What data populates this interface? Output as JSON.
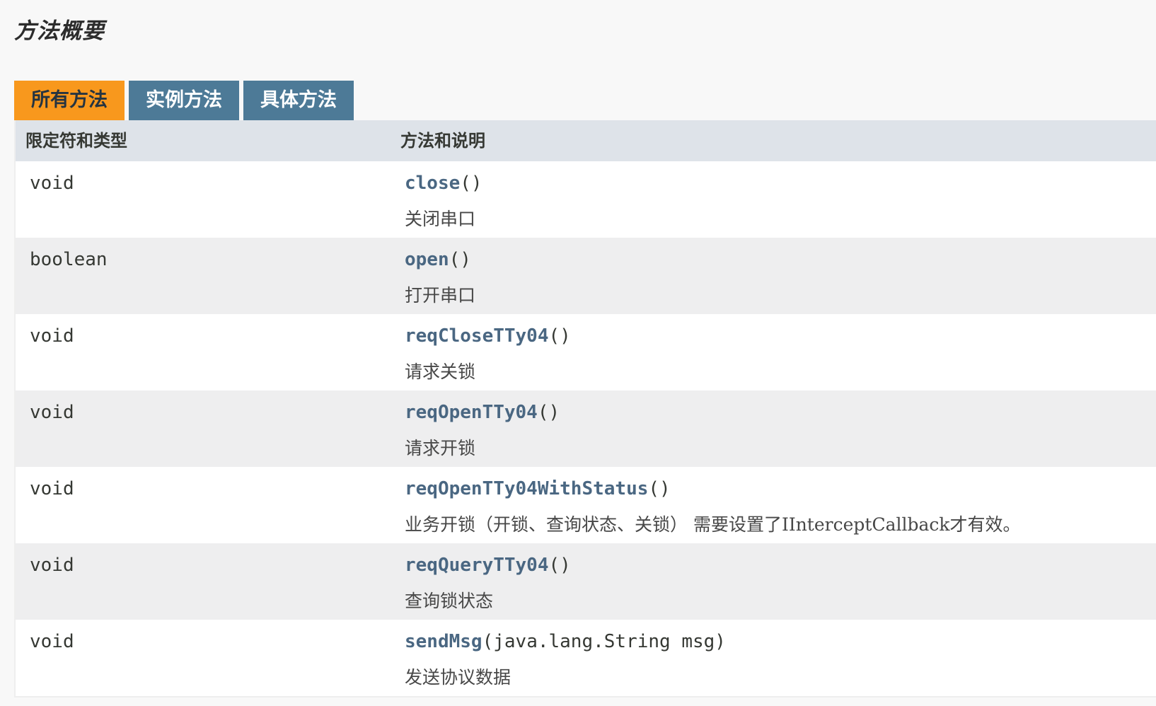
{
  "section": {
    "title": "方法概要"
  },
  "tabs": [
    {
      "label": "所有方法",
      "active": true
    },
    {
      "label": "实例方法",
      "active": false
    },
    {
      "label": "具体方法",
      "active": false
    }
  ],
  "table": {
    "headers": {
      "col1": "限定符和类型",
      "col2": "方法和说明"
    },
    "rows": [
      {
        "type": "void",
        "name": "close",
        "params": "()",
        "desc": "关闭串口"
      },
      {
        "type": "boolean",
        "name": "open",
        "params": "()",
        "desc": "打开串口"
      },
      {
        "type": "void",
        "name": "reqCloseTTy04",
        "params": "()",
        "desc": "请求关锁"
      },
      {
        "type": "void",
        "name": "reqOpenTTy04",
        "params": "()",
        "desc": "请求开锁"
      },
      {
        "type": "void",
        "name": "reqOpenTTy04WithStatus",
        "params": "()",
        "desc": "业务开锁（开锁、查询状态、关锁） 需要设置了IInterceptCallback才有效。"
      },
      {
        "type": "void",
        "name": "reqQueryTTy04",
        "params": "()",
        "desc": "查询锁状态"
      },
      {
        "type": "void",
        "name": "sendMsg",
        "params": "(java.lang.String msg)",
        "desc": "发送协议数据"
      }
    ]
  },
  "colors": {
    "active_tab": "#f8981d",
    "inactive_tab": "#4d7a97",
    "header_bg": "#dee3e9",
    "row_alt": "#eeeeef",
    "link": "#4a6782"
  }
}
